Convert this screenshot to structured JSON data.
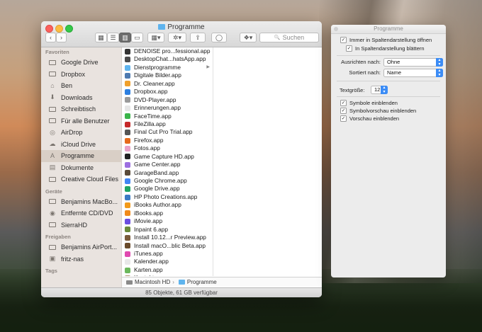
{
  "window": {
    "title": "Programme",
    "search_placeholder": "Suchen",
    "status": "85 Objekte, 61 GB verfügbar",
    "path": [
      "Macintosh HD",
      "Programme"
    ]
  },
  "toolbar": {
    "back": "‹",
    "forward": "›",
    "view_icons": "▦",
    "view_list": "☰",
    "view_columns": "▥",
    "view_coverflow": "▭",
    "arrange": "▦▾",
    "action": "✲▾",
    "share": "⇪",
    "tags": "◯",
    "dropbox": "❖▾",
    "search_icon": "🔍"
  },
  "sidebar": {
    "favorites_heading": "Favoriten",
    "favorites": [
      {
        "label": "Google Drive",
        "icon": "folder-icon"
      },
      {
        "label": "Dropbox",
        "icon": "folder-icon"
      },
      {
        "label": "Ben",
        "icon": "home-icon"
      },
      {
        "label": "Downloads",
        "icon": "downloads-icon"
      },
      {
        "label": "Schreibtisch",
        "icon": "folder-icon"
      },
      {
        "label": "Für alle Benutzer",
        "icon": "folder-icon"
      },
      {
        "label": "AirDrop",
        "icon": "airdrop-icon"
      },
      {
        "label": "iCloud Drive",
        "icon": "cloud-icon"
      },
      {
        "label": "Programme",
        "icon": "applications-icon"
      },
      {
        "label": "Dokumente",
        "icon": "documents-icon"
      },
      {
        "label": "Creative Cloud Files",
        "icon": "folder-icon"
      }
    ],
    "devices_heading": "Geräte",
    "devices": [
      {
        "label": "Benjamins MacBo...",
        "icon": "laptop-icon"
      },
      {
        "label": "Entfernte CD/DVD",
        "icon": "disc-icon"
      },
      {
        "label": "SierraHD",
        "icon": "disk-icon"
      }
    ],
    "shared_heading": "Freigaben",
    "shared": [
      {
        "label": "Benjamins AirPort...",
        "icon": "monitor-icon"
      },
      {
        "label": "fritz-nas",
        "icon": "server-icon"
      }
    ],
    "tags_heading": "Tags"
  },
  "apps": [
    {
      "label": "DENOISE pro...fessional.app",
      "color": "#333333"
    },
    {
      "label": "DesktopChat...hatsApp.app",
      "color": "#4a4a4a"
    },
    {
      "label": "Dienstprogramme",
      "color": "#5fb4ee",
      "folder": true
    },
    {
      "label": "Digitale Bilder.app",
      "color": "#4e7ab0"
    },
    {
      "label": "Dr. Cleaner.app",
      "color": "#f0a02c"
    },
    {
      "label": "Dropbox.app",
      "color": "#2d7fe0"
    },
    {
      "label": "DVD-Player.app",
      "color": "#9a9a9a"
    },
    {
      "label": "Erinnerungen.app",
      "color": "#e6e6e6"
    },
    {
      "label": "FaceTime.app",
      "color": "#3bb44a"
    },
    {
      "label": "FileZilla.app",
      "color": "#c62828"
    },
    {
      "label": "Final Cut Pro Trial.app",
      "color": "#555555"
    },
    {
      "label": "Firefox.app",
      "color": "#e66a1c"
    },
    {
      "label": "Fotos.app",
      "color": "#e9a1c9"
    },
    {
      "label": "Game Capture HD.app",
      "color": "#222222"
    },
    {
      "label": "Game Center.app",
      "color": "#9c6ee0"
    },
    {
      "label": "GarageBand.app",
      "color": "#5a4a3a"
    },
    {
      "label": "Google Chrome.app",
      "color": "#4285f4"
    },
    {
      "label": "Google Drive.app",
      "color": "#1fa463"
    },
    {
      "label": "HP Photo Creations.app",
      "color": "#3b7ac4"
    },
    {
      "label": "iBooks Author.app",
      "color": "#f29a1a"
    },
    {
      "label": "iBooks.app",
      "color": "#f08a1a"
    },
    {
      "label": "iMovie.app",
      "color": "#6b4ee0"
    },
    {
      "label": "Inpaint 6.app",
      "color": "#6a8a3a"
    },
    {
      "label": "Install 10.12...r Preview.app",
      "color": "#7a5a3a"
    },
    {
      "label": "Install macO...blic Beta.app",
      "color": "#6a4a2a"
    },
    {
      "label": "iTunes.app",
      "color": "#e04ab0"
    },
    {
      "label": "Kalender.app",
      "color": "#e8e8e8"
    },
    {
      "label": "Karten.app",
      "color": "#6cb85c"
    },
    {
      "label": "Kontakte.app",
      "color": "#b09070"
    }
  ],
  "panel": {
    "title": "Programme",
    "always_columns": "Immer in Spaltendarstellung öffnen",
    "browse_columns": "In Spaltendarstellung blättern",
    "arrange_label": "Ausrichten nach:",
    "arrange_value": "Ohne",
    "sort_label": "Sortiert nach:",
    "sort_value": "Name",
    "textsize_label": "Textgröße:",
    "textsize_value": "12",
    "show_icons": "Symbole einblenden",
    "show_icon_preview": "Symbolvorschau einblenden",
    "show_preview": "Vorschau einblenden",
    "check": "✓"
  }
}
